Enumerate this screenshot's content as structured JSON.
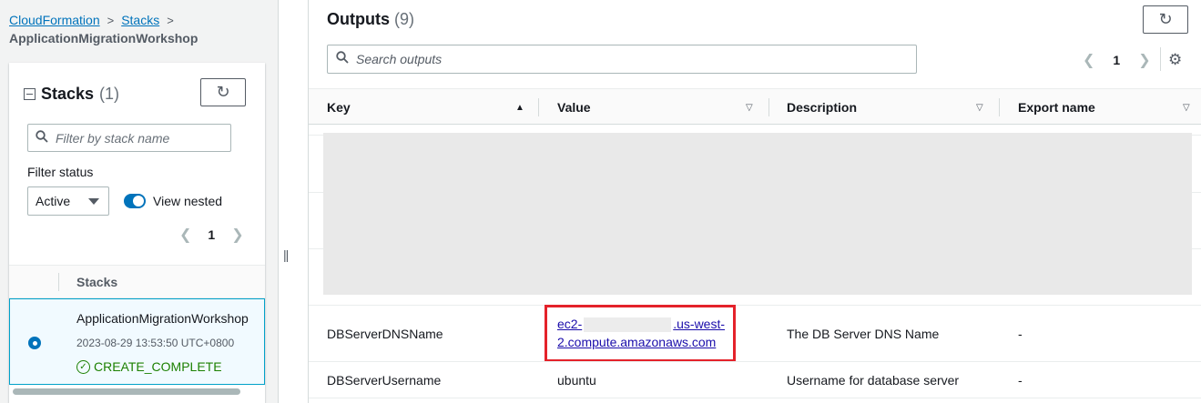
{
  "breadcrumb": {
    "root": "CloudFormation",
    "stacks": "Stacks",
    "current": "ApplicationMigrationWorkshop"
  },
  "stacks_panel": {
    "title": "Stacks",
    "count": "(1)",
    "filter_placeholder": "Filter by stack name",
    "filter_status_label": "Filter status",
    "filter_status_value": "Active",
    "view_nested_label": "View nested",
    "page": "1",
    "column_header": "Stacks",
    "stack": {
      "name": "ApplicationMigrationWorkshop",
      "timestamp": "2023-08-29 13:53:50 UTC+0800",
      "status": "CREATE_COMPLETE"
    }
  },
  "outputs_panel": {
    "title": "Outputs",
    "count": "(9)",
    "search_placeholder": "Search outputs",
    "page": "1",
    "columns": [
      "Key",
      "Value",
      "Description",
      "Export name"
    ],
    "rows": [
      {
        "key": "DBServerDNSName",
        "value_prefix": "ec2-",
        "value_suffix": ".us-west-",
        "value_line2": "2.compute.amazonaws.com",
        "description": "The DB Server DNS Name",
        "export": "-"
      },
      {
        "key": "DBServerUsername",
        "value": "ubuntu",
        "description": "Username for database server",
        "export": "-"
      }
    ]
  },
  "colors": {
    "link": "#0073bb",
    "success": "#1d8102",
    "highlight": "#e4222a",
    "selected_row_bg": "#f1faff"
  }
}
